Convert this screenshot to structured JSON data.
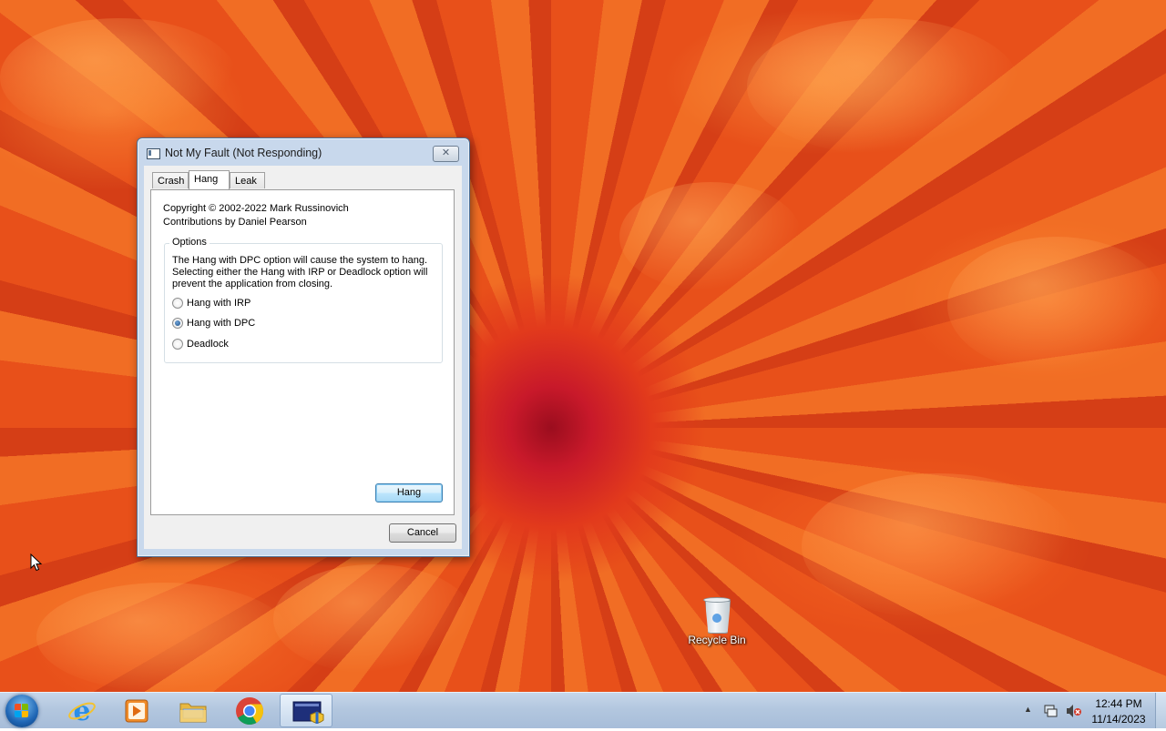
{
  "window": {
    "title": "Not My Fault (Not Responding)",
    "close_glyph": "✕",
    "tabs": [
      "Crash",
      "Hang",
      "Leak"
    ],
    "active_tab": "Hang",
    "copyright": "Copyright © 2002-2022 Mark Russinovich",
    "contributions": "Contributions by Daniel Pearson",
    "options": {
      "label": "Options",
      "description": "The Hang with DPC option will cause the system to hang. Selecting either the Hang with IRP or Deadlock option will prevent the application from closing.",
      "radios": [
        {
          "label": "Hang with IRP",
          "checked": false
        },
        {
          "label": "Hang with DPC",
          "checked": true
        },
        {
          "label": "Deadlock",
          "checked": false
        }
      ]
    },
    "hang_button": "Hang",
    "cancel_button": "Cancel"
  },
  "desktop": {
    "recycle_bin_label": "Recycle Bin"
  },
  "taskbar": {
    "pinned": [
      "internet-explorer-icon",
      "media-player-icon",
      "file-explorer-icon",
      "chrome-icon",
      "notmyfault-icon"
    ],
    "tray_chevron": "▲",
    "clock_time": "12:44 PM",
    "clock_date": "11/14/2023"
  },
  "colors": {
    "window_frame": "#c8d8ec",
    "default_button": "#bee6fd",
    "taskbar": "#b3c7df"
  }
}
